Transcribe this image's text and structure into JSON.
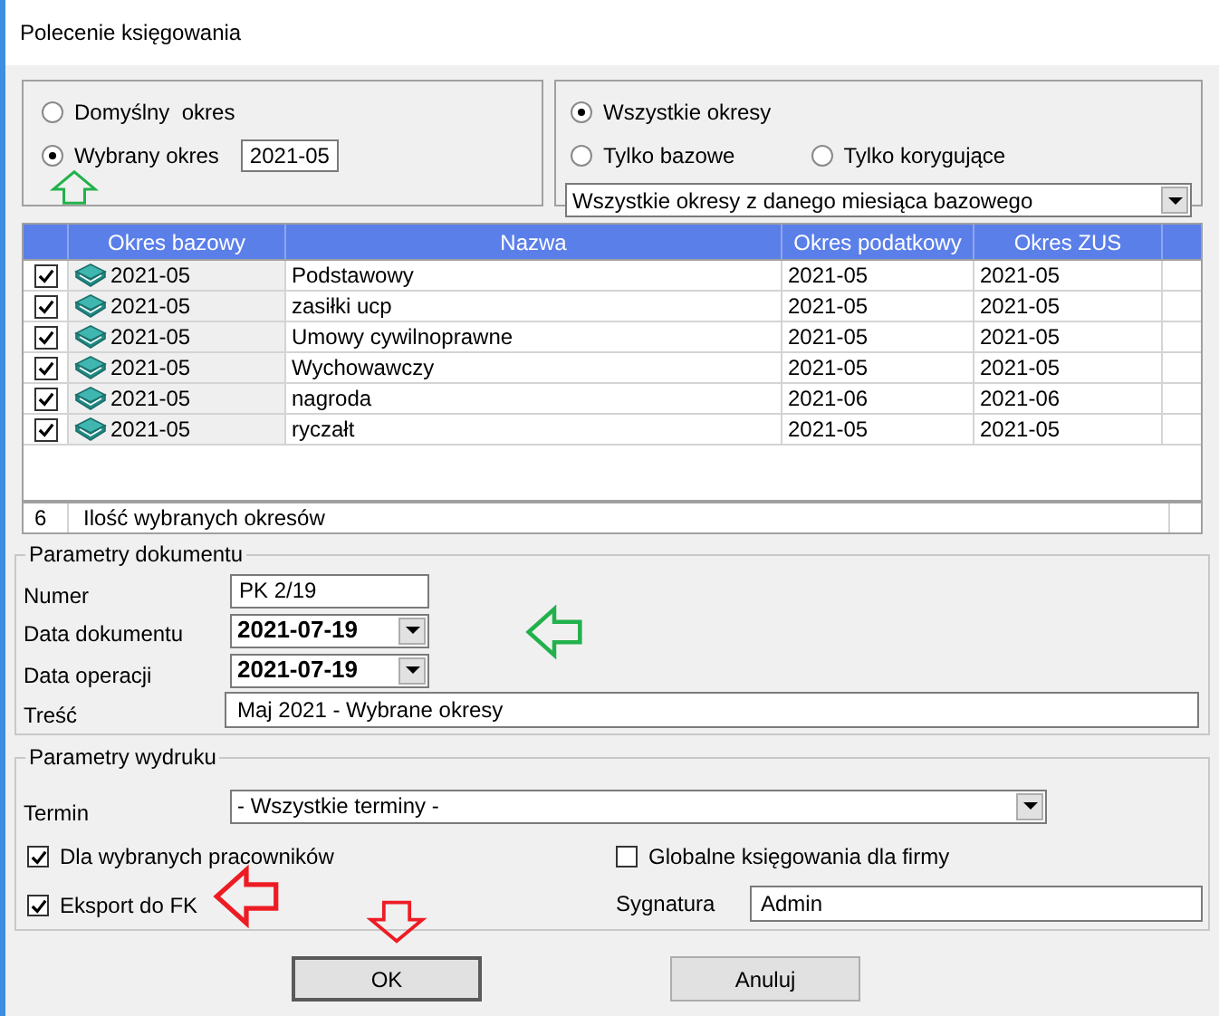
{
  "window": {
    "title": "Polecenie księgowania"
  },
  "period_mode": {
    "options": [
      {
        "label": "Domyślny  okres",
        "selected": false
      },
      {
        "label": "Wybrany okres",
        "selected": true
      }
    ],
    "value": "2021-05"
  },
  "period_filter": {
    "options": [
      {
        "label": "Wszystkie okresy",
        "selected": true
      },
      {
        "label": "Tylko bazowe",
        "selected": false
      },
      {
        "label": "Tylko korygujące",
        "selected": false
      }
    ],
    "dropdown": "Wszystkie okresy z danego miesiąca bazowego"
  },
  "table": {
    "columns": [
      "Okres bazowy",
      "Nazwa",
      "Okres podatkowy",
      "Okres ZUS"
    ],
    "rows": [
      {
        "checked": true,
        "cells": [
          "2021-05",
          "Podstawowy",
          "2021-05",
          "2021-05"
        ]
      },
      {
        "checked": true,
        "cells": [
          "2021-05",
          "zasiłki ucp",
          "2021-05",
          "2021-05"
        ]
      },
      {
        "checked": true,
        "cells": [
          "2021-05",
          "Umowy cywilnoprawne",
          "2021-05",
          "2021-05"
        ]
      },
      {
        "checked": true,
        "cells": [
          "2021-05",
          "Wychowawczy",
          "2021-05",
          "2021-05"
        ]
      },
      {
        "checked": true,
        "cells": [
          "2021-05",
          "nagroda",
          "2021-06",
          "2021-06"
        ]
      },
      {
        "checked": true,
        "cells": [
          "2021-05",
          "ryczałt",
          "2021-05",
          "2021-05"
        ]
      }
    ],
    "footer": {
      "count": "6",
      "label": "Ilość wybranych okresów"
    }
  },
  "document": {
    "title": "Parametry dokumentu",
    "numer_label": "Numer",
    "numer": "PK 2/19",
    "data_dokumentu_label": "Data dokumentu",
    "data_dokumentu": "2021-07-19",
    "data_operacji_label": "Data operacji",
    "data_operacji": "2021-07-19",
    "tresc_label": "Treść",
    "tresc": "Maj 2021 - Wybrane okresy"
  },
  "print": {
    "title": "Parametry wydruku",
    "termin_label": "Termin",
    "termin": "- Wszystkie terminy -",
    "checkboxes": [
      {
        "label": "Dla wybranych pracowników",
        "checked": true
      },
      {
        "label": "Globalne księgowania dla firmy",
        "checked": false
      },
      {
        "label": "Eksport do FK",
        "checked": true
      }
    ],
    "sygnatura_label": "Sygnatura",
    "sygnatura": "Admin"
  },
  "buttons": [
    "OK",
    "Anuluj"
  ]
}
